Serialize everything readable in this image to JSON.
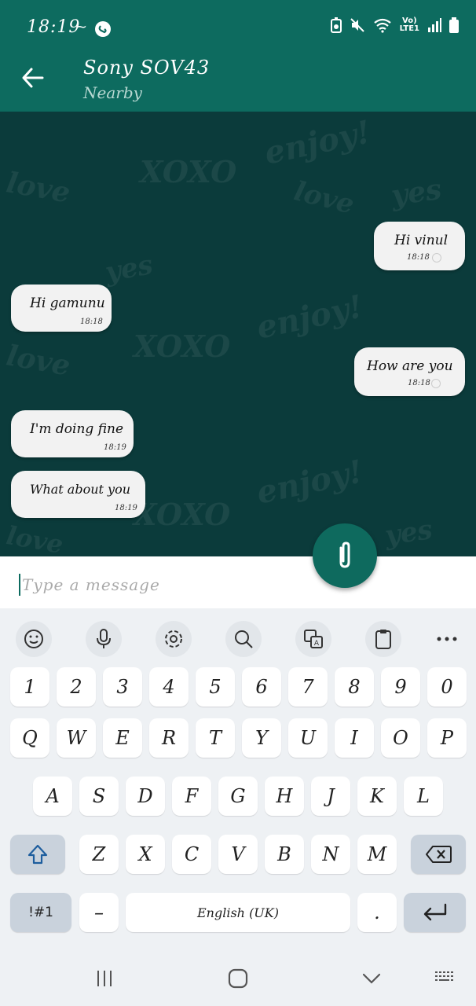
{
  "status": {
    "time": "18:19",
    "misc": "~",
    "vo_top": "Vo)",
    "vo_bottom": "LTE1"
  },
  "header": {
    "title": "Sony SOV43",
    "subtitle": "Nearby"
  },
  "messages": [
    {
      "dir": "out",
      "text": "Hi vinul",
      "time": "18:18"
    },
    {
      "dir": "in",
      "text": "Hi gamunu",
      "time": "18:18"
    },
    {
      "dir": "out",
      "text": "How are you",
      "time": "18:18"
    },
    {
      "dir": "in",
      "text": "I'm doing fine",
      "time": "18:19"
    },
    {
      "dir": "in",
      "text": "What about you",
      "time": "18:19"
    }
  ],
  "input": {
    "placeholder": "Type a message"
  },
  "keyboard": {
    "toolbar": [
      "emoji-icon",
      "microphone-icon",
      "settings-icon",
      "search-icon",
      "translate-icon",
      "clipboard-icon",
      "more-icon"
    ],
    "row_numbers": [
      "1",
      "2",
      "3",
      "4",
      "5",
      "6",
      "7",
      "8",
      "9",
      "0"
    ],
    "row_top": [
      "Q",
      "W",
      "E",
      "R",
      "T",
      "Y",
      "U",
      "I",
      "O",
      "P"
    ],
    "row_home": [
      "A",
      "S",
      "D",
      "F",
      "G",
      "H",
      "J",
      "K",
      "L"
    ],
    "row_bottom": [
      "Z",
      "X",
      "C",
      "V",
      "B",
      "N",
      "M"
    ],
    "symbols": "!#1",
    "dash": "–",
    "space": "English (UK)",
    "period": "."
  },
  "colors": {
    "header": "#0d6b5f",
    "chat_bg": "#0b3b3b",
    "bubble": "#f2f2f2",
    "fab": "#0e6a5e"
  }
}
